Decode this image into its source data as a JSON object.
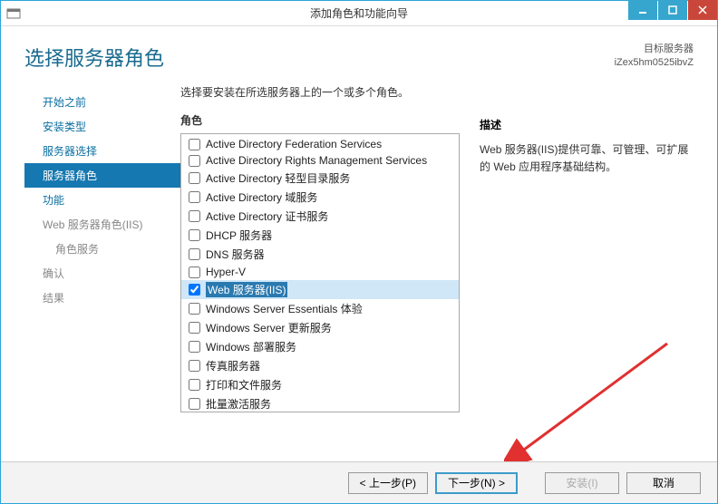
{
  "titlebar": {
    "title": "添加角色和功能向导"
  },
  "header": {
    "page_title": "选择服务器角色",
    "target_label": "目标服务器",
    "target_value": "iZex5hm0525ibvZ"
  },
  "sidebar": {
    "items": [
      {
        "label": "开始之前",
        "enabled": true,
        "active": false
      },
      {
        "label": "安装类型",
        "enabled": true,
        "active": false
      },
      {
        "label": "服务器选择",
        "enabled": true,
        "active": false
      },
      {
        "label": "服务器角色",
        "enabled": true,
        "active": true
      },
      {
        "label": "功能",
        "enabled": true,
        "active": false
      },
      {
        "label": "Web 服务器角色(IIS)",
        "enabled": false,
        "active": false
      },
      {
        "label": "角色服务",
        "enabled": false,
        "active": false,
        "sub": true
      },
      {
        "label": "确认",
        "enabled": false,
        "active": false
      },
      {
        "label": "结果",
        "enabled": false,
        "active": false
      }
    ]
  },
  "main": {
    "instruction": "选择要安装在所选服务器上的一个或多个角色。",
    "roles_label": "角色",
    "roles": [
      {
        "label": "Active Directory Federation Services",
        "checked": false
      },
      {
        "label": "Active Directory Rights Management Services",
        "checked": false
      },
      {
        "label": "Active Directory 轻型目录服务",
        "checked": false
      },
      {
        "label": "Active Directory 域服务",
        "checked": false
      },
      {
        "label": "Active Directory 证书服务",
        "checked": false
      },
      {
        "label": "DHCP 服务器",
        "checked": false
      },
      {
        "label": "DNS 服务器",
        "checked": false
      },
      {
        "label": "Hyper-V",
        "checked": false
      },
      {
        "label": "Web 服务器(IIS)",
        "checked": true,
        "selected": true
      },
      {
        "label": "Windows Server Essentials 体验",
        "checked": false
      },
      {
        "label": "Windows Server 更新服务",
        "checked": false
      },
      {
        "label": "Windows 部署服务",
        "checked": false
      },
      {
        "label": "传真服务器",
        "checked": false
      },
      {
        "label": "打印和文件服务",
        "checked": false
      },
      {
        "label": "批量激活服务",
        "checked": false
      }
    ],
    "desc_label": "描述",
    "desc_text": "Web 服务器(IIS)提供可靠、可管理、可扩展的 Web 应用程序基础结构。"
  },
  "footer": {
    "prev": "< 上一步(P)",
    "next": "下一步(N) >",
    "install": "安装(I)",
    "cancel": "取消"
  }
}
